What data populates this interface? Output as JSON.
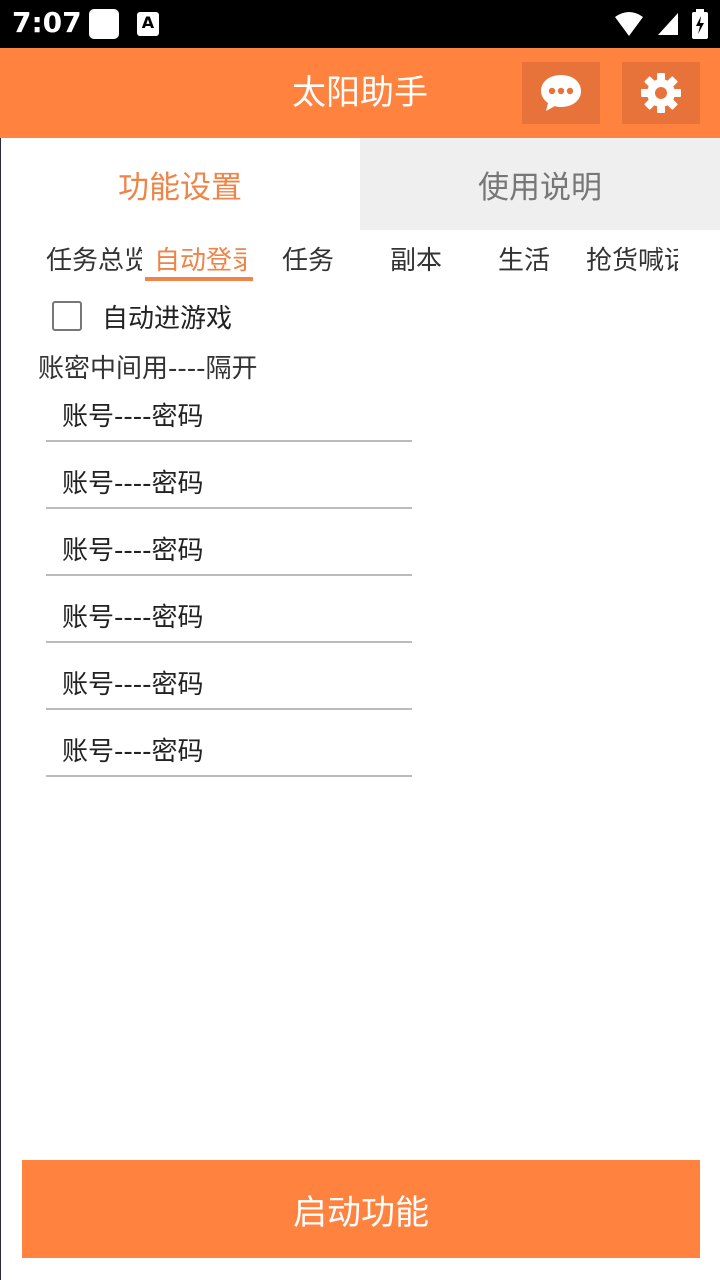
{
  "status_bar": {
    "time": "7:07",
    "a_icon": "A"
  },
  "app_bar": {
    "title": "太阳助手",
    "chat_icon": "chat-bubble-icon",
    "settings_icon": "gear-icon"
  },
  "main_tabs": [
    {
      "label": "功能设置",
      "active": true
    },
    {
      "label": "使用说明",
      "active": false
    }
  ],
  "sub_tabs": [
    {
      "label": "任务总览",
      "active": false
    },
    {
      "label": "自动登录",
      "active": true
    },
    {
      "label": "任务",
      "active": false
    },
    {
      "label": "副本",
      "active": false
    },
    {
      "label": "生活",
      "active": false
    },
    {
      "label": "抢货喊话",
      "active": false
    }
  ],
  "auto_enter": {
    "label": "自动进游戏",
    "checked": false
  },
  "hint": "账密中间用----隔开",
  "accounts": [
    {
      "placeholder": "账号----密码",
      "value": ""
    },
    {
      "placeholder": "账号----密码",
      "value": ""
    },
    {
      "placeholder": "账号----密码",
      "value": ""
    },
    {
      "placeholder": "账号----密码",
      "value": ""
    },
    {
      "placeholder": "账号----密码",
      "value": ""
    },
    {
      "placeholder": "账号----密码",
      "value": ""
    }
  ],
  "start_button": "启动功能",
  "colors": {
    "accent": "#ff823e",
    "accent_dark": "#e8733a",
    "active_tab_text": "#ee8447"
  }
}
